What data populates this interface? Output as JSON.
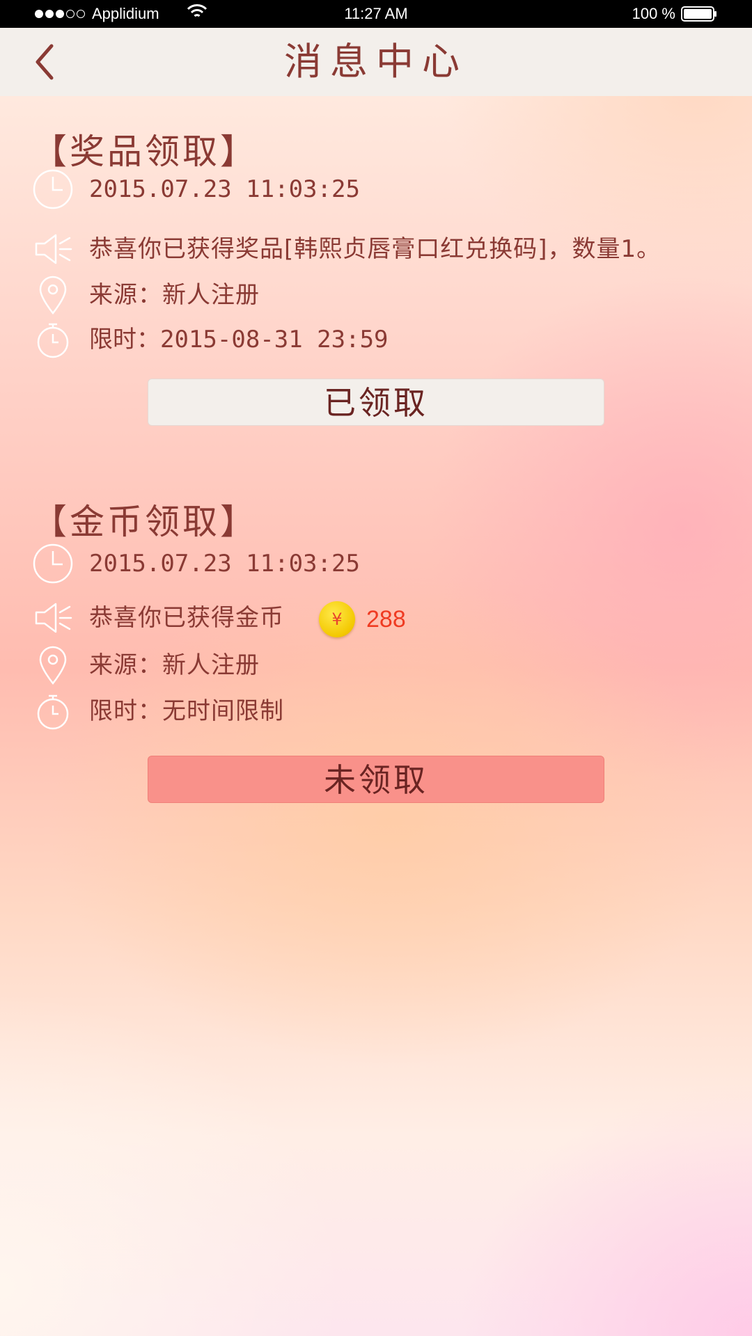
{
  "status_bar": {
    "carrier": "Applidium",
    "time": "11:27 AM",
    "battery": "100 %",
    "signal_dots_filled": 3,
    "signal_dots_total": 5
  },
  "nav": {
    "title": "消息中心",
    "back_icon": "chevron-left-icon"
  },
  "messages": [
    {
      "title": "【奖品领取】",
      "time": "2015.07.23  11:03:25",
      "content": "恭喜你已获得奖品[韩熙贞唇膏口红兑换码]，数量1。",
      "source": "来源：新人注册",
      "limit": "限时：2015-08-31  23:59",
      "button": "已领取"
    },
    {
      "title": "【金币领取】",
      "time": "2015.07.23  11:03:25",
      "content": "恭喜你已获得金币",
      "coin_symbol": "¥",
      "coin_amount": "288",
      "source": "来源：新人注册",
      "limit": "限时：无时间限制",
      "button": "未领取"
    }
  ],
  "colors": {
    "text": "#8a3a34",
    "coin_amount": "#ef3b22",
    "claimed_button": "#f3efeb",
    "unclaimed_button": "#f9918a"
  }
}
